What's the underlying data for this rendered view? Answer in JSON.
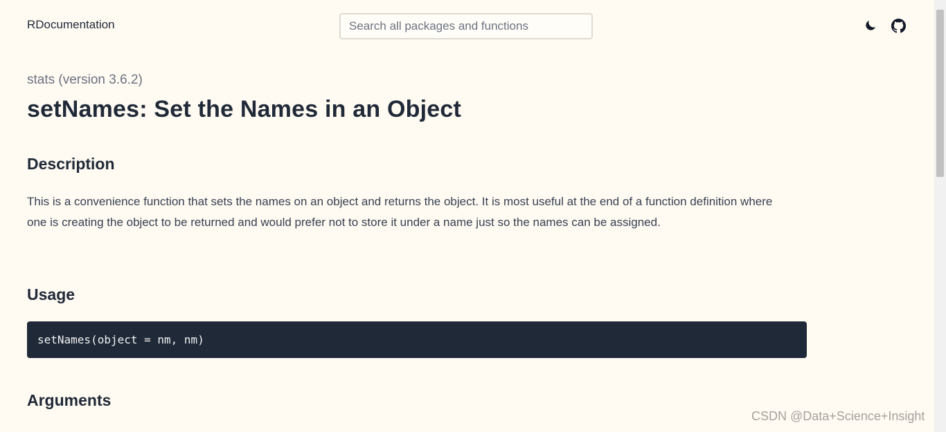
{
  "header": {
    "brand": "RDocumentation",
    "search_placeholder": "Search all packages and functions"
  },
  "icons": {
    "theme_toggle": "moon-icon",
    "repo_link": "github-icon"
  },
  "main": {
    "package_version": "stats (version 3.6.2)",
    "title": "setNames: Set the Names in an Object",
    "description_heading": "Description",
    "description_text": "This is a convenience function that sets the names on an object and returns the object. It is most useful at the end of a function definition where one is creating the object to be returned and would prefer not to store it under a name just so the names can be assigned.",
    "usage_heading": "Usage",
    "usage_code": "setNames(object = nm, nm)",
    "arguments_heading": "Arguments"
  },
  "watermark": "CSDN @Data+Science+Insight",
  "colors": {
    "background": "#fffaf2",
    "text": "#1f2937",
    "muted": "#6b7280",
    "code_bg": "#1f2937"
  }
}
